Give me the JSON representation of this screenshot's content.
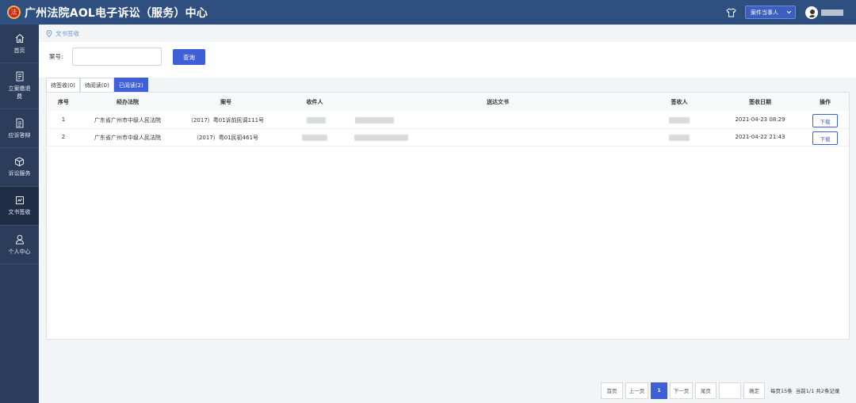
{
  "header": {
    "title": "广州法院AOL电子诉讼（服务）中心",
    "logo_text": "法",
    "role_select": "案件当事人",
    "icons": [
      "shirt-icon",
      "chevron-down-icon",
      "avatar"
    ]
  },
  "sidebar": {
    "items": [
      {
        "label": "首页",
        "icon": "home-icon"
      },
      {
        "label": "立案缴退费",
        "icon": "file-icon"
      },
      {
        "label": "应诉答辩",
        "icon": "document-icon"
      },
      {
        "label": "诉讼服务",
        "icon": "box-icon"
      },
      {
        "label": "文书签收",
        "icon": "signature-icon",
        "active": true
      },
      {
        "label": "个人中心",
        "icon": "user-icon"
      }
    ]
  },
  "breadcrumb": {
    "label": "文书签收",
    "icon": "location-icon"
  },
  "search": {
    "case_label": "案号:",
    "case_value": "",
    "query_button": "查询"
  },
  "tabs": [
    {
      "label": "待签收(0)",
      "active": false
    },
    {
      "label": "待阅读(0)",
      "active": false
    },
    {
      "label": "已阅读(2)",
      "active": true
    }
  ],
  "table": {
    "columns": [
      "序号",
      "经办法院",
      "案号",
      "收件人",
      "送达文书",
      "签收人",
      "签收日期",
      "操作"
    ],
    "rows": [
      {
        "index": "1",
        "court": "广东省广州市中级人民法院",
        "case_no": "（2017）粤01诉前民调111号",
        "date": "2021-04-23 08:29",
        "action": "下载"
      },
      {
        "index": "2",
        "court": "广东省广州市中级人民法院",
        "case_no": "（2017）粤01民初461号",
        "date": "2021-04-22 21:43",
        "action": "下载"
      }
    ]
  },
  "pagination": {
    "first": "首页",
    "prev": "上一页",
    "current": "1",
    "next": "下一页",
    "last": "尾页",
    "jump_value": "",
    "confirm": "确定",
    "per_page": "每页15条",
    "summary": "当前1/1 共2条记录"
  },
  "colors": {
    "topbar": "#2e4f7f",
    "sidebar": "#2b3d5b",
    "accent": "#3e5fd6",
    "breadcrumb": "#6c9ad3"
  }
}
